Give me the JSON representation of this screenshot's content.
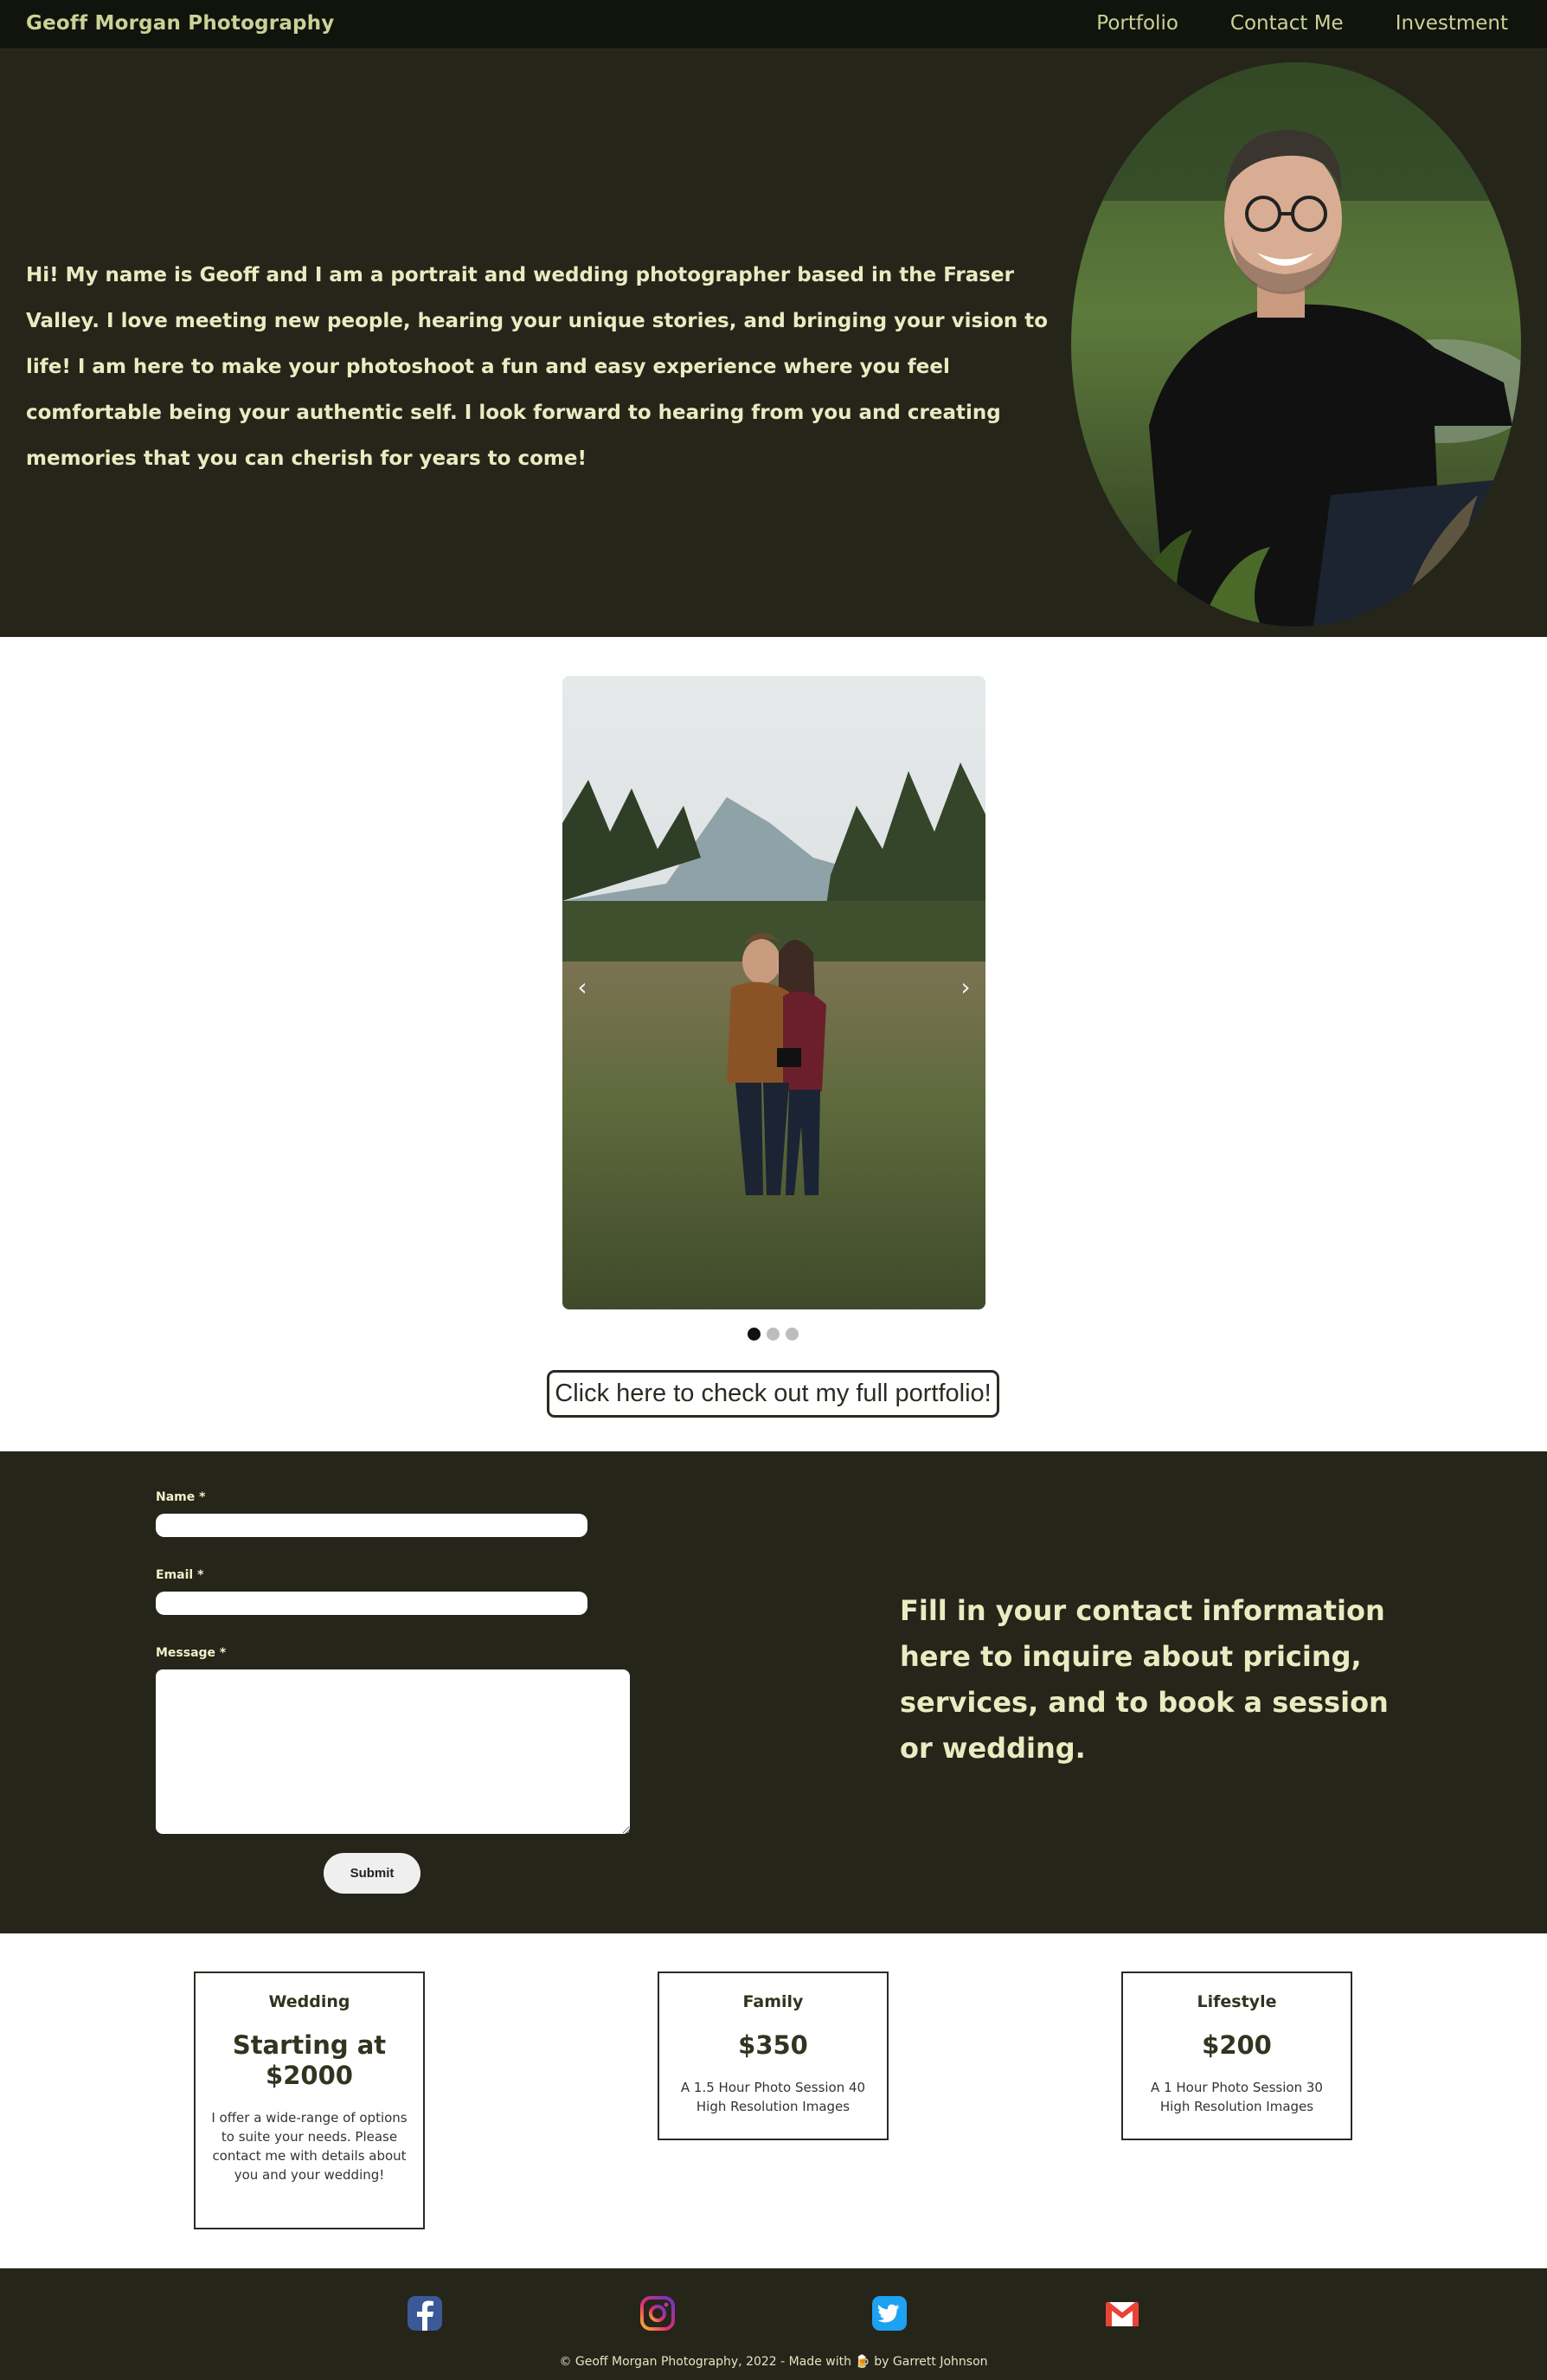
{
  "nav": {
    "brand": "Geoff Morgan Photography",
    "links": [
      "Portfolio",
      "Contact Me",
      "Investment"
    ]
  },
  "hero": {
    "bio": "Hi! My name is Geoff and I am a portrait and wedding photographer based in the Fraser Valley. I love meeting new people, hearing your unique stories, and bringing your vision to life! I am here to make your photoshoot a fun and easy experience where you feel comfortable being your authentic self. I look forward to hearing from you and creating memories that you can cherish for years to come!"
  },
  "carousel": {
    "prev_icon": "‹",
    "next_icon": "›",
    "slide_count": 3,
    "active_slide": 1
  },
  "portfolio_button": "Click here to check out my full portfolio!",
  "contact": {
    "name_label": "Name *",
    "email_label": "Email *",
    "message_label": "Message *",
    "submit_label": "Submit",
    "blurb": "Fill in your contact information here to inquire about pricing, services, and to book a session or wedding."
  },
  "pricing": [
    {
      "title": "Wedding",
      "price": "Starting at $2000",
      "description": "I offer a wide-range of options to suite your needs. Please contact me with details about you and your wedding!"
    },
    {
      "title": "Family",
      "price": "$350",
      "description": "A 1.5 Hour Photo Session 40 High Resolution Images"
    },
    {
      "title": "Lifestyle",
      "price": "$200",
      "description": "A 1 Hour Photo Session 30 High Resolution Images"
    }
  ],
  "footer": {
    "social_icons": [
      "facebook-icon",
      "instagram-icon",
      "twitter-icon",
      "gmail-icon"
    ],
    "copyright": "© Geoff Morgan Photography, 2022 - Made with 🍺 by Garrett Johnson"
  },
  "colors": {
    "dark_bg": "#25251a",
    "nav_bg": "#11130d",
    "accent_text": "#c8d395",
    "light_text": "#e9ecc1"
  }
}
